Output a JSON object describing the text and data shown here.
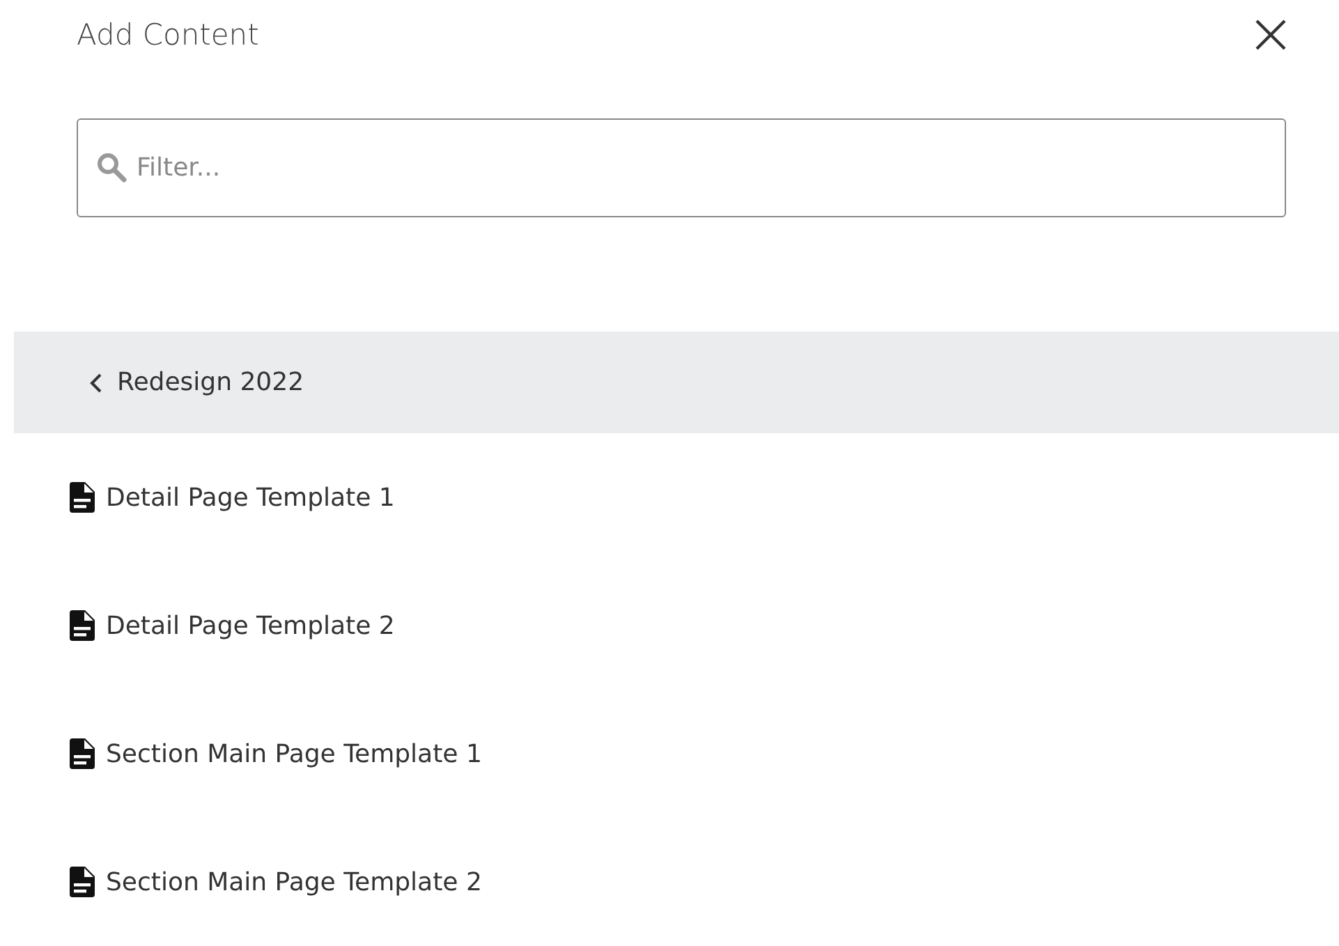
{
  "panel": {
    "title": "Add Content"
  },
  "search": {
    "placeholder": "Filter..."
  },
  "breadcrumb": {
    "label": "Redesign 2022"
  },
  "items": [
    {
      "label": "Detail Page Template 1"
    },
    {
      "label": "Detail Page Template 2"
    },
    {
      "label": "Section Main Page Template 1"
    },
    {
      "label": "Section Main Page Template 2"
    }
  ]
}
